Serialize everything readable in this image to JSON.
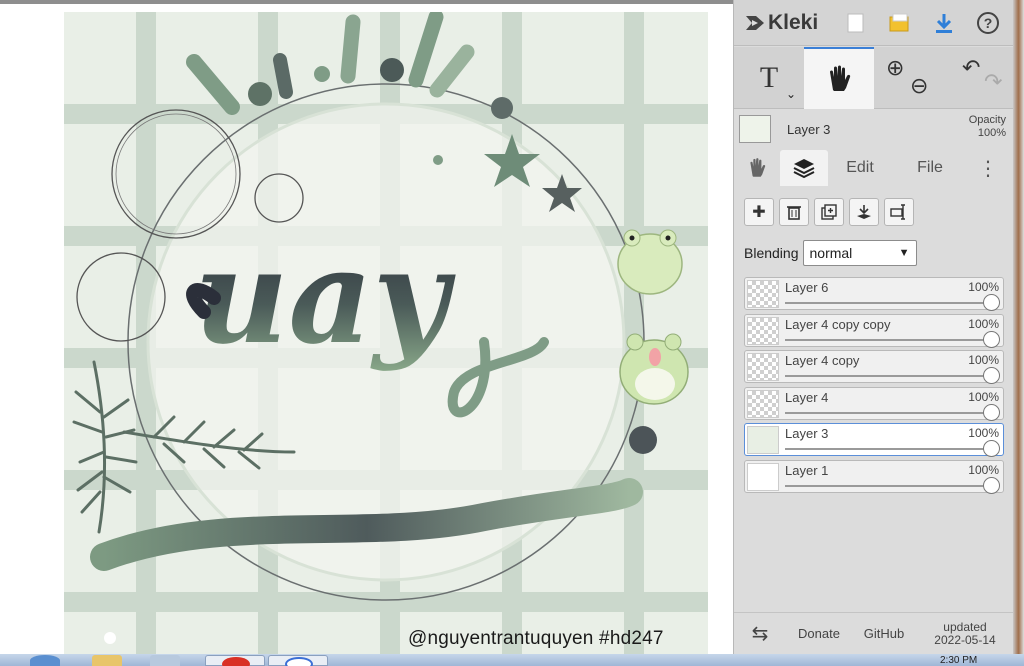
{
  "app": {
    "name": "Kleki",
    "brand_color": "#3a3a3a",
    "accent": "#3b7fd6"
  },
  "toolbar": {
    "new_icon": "new-page-icon",
    "open_icon": "folder-icon",
    "save_icon": "download-icon",
    "help_label": "?"
  },
  "tools": {
    "text_label": "T",
    "hand_icon": "hand-icon",
    "zoom_in_label": "⊕",
    "zoom_out_label": "⊖",
    "undo_label": "↶",
    "redo_label": "↷"
  },
  "current_layer": {
    "name": "Layer 3",
    "opacity_label": "Opacity",
    "opacity_value": "100%"
  },
  "tabs": {
    "edit": "Edit",
    "file": "File",
    "more": "⋮"
  },
  "layers_panel": {
    "blending_label": "Blending",
    "blending_value": "normal",
    "layers": [
      {
        "name": "Layer 6",
        "opacity": "100%",
        "selected": false
      },
      {
        "name": "Layer 4 copy copy",
        "opacity": "100%",
        "selected": false
      },
      {
        "name": "Layer 4 copy",
        "opacity": "100%",
        "selected": false
      },
      {
        "name": "Layer 4",
        "opacity": "100%",
        "selected": false
      },
      {
        "name": "Layer 3",
        "opacity": "100%",
        "selected": true
      },
      {
        "name": "Layer 1",
        "opacity": "100%",
        "selected": false
      }
    ]
  },
  "footer": {
    "swap_label": "⇆",
    "donate": "Donate",
    "github": "GitHub",
    "updated_line1": "updated",
    "updated_line2": "2022-05-14"
  },
  "canvas": {
    "watermark": "@nguyentrantuquyen   #hd247",
    "art_text": "uay"
  },
  "taskbar": {
    "clock": "2:30 PM"
  }
}
